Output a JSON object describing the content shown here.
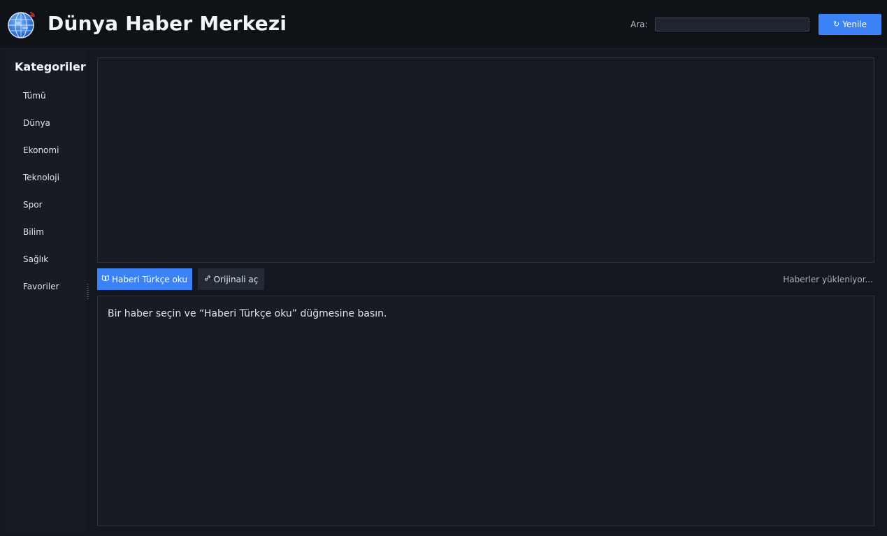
{
  "header": {
    "title": "Dünya Haber Merkezi",
    "search_label": "Ara:",
    "search_value": "",
    "search_placeholder": "",
    "refresh_label": "Yenile",
    "refresh_icon": "refresh-icon",
    "logo": "globe-logo"
  },
  "sidebar": {
    "title": "Kategoriler",
    "items": [
      {
        "label": "Tümü"
      },
      {
        "label": "Dünya"
      },
      {
        "label": "Ekonomi"
      },
      {
        "label": "Teknoloji"
      },
      {
        "label": "Spor"
      },
      {
        "label": "Bilim"
      },
      {
        "label": "Sağlık"
      },
      {
        "label": "Favoriler"
      }
    ]
  },
  "toolbar": {
    "read_label": "Haberi Türkçe oku",
    "read_icon": "book-icon",
    "open_original_label": "Orijinali aç",
    "open_original_icon": "link-icon",
    "status": "Haberler yükleniyor..."
  },
  "reader": {
    "message": "Bir haber seçin ve “Haberi Türkçe oku” düğmesine basın."
  },
  "colors": {
    "accent": "#3b82f6",
    "background": "#131720",
    "panel": "#171b24",
    "header": "#0f1217"
  }
}
